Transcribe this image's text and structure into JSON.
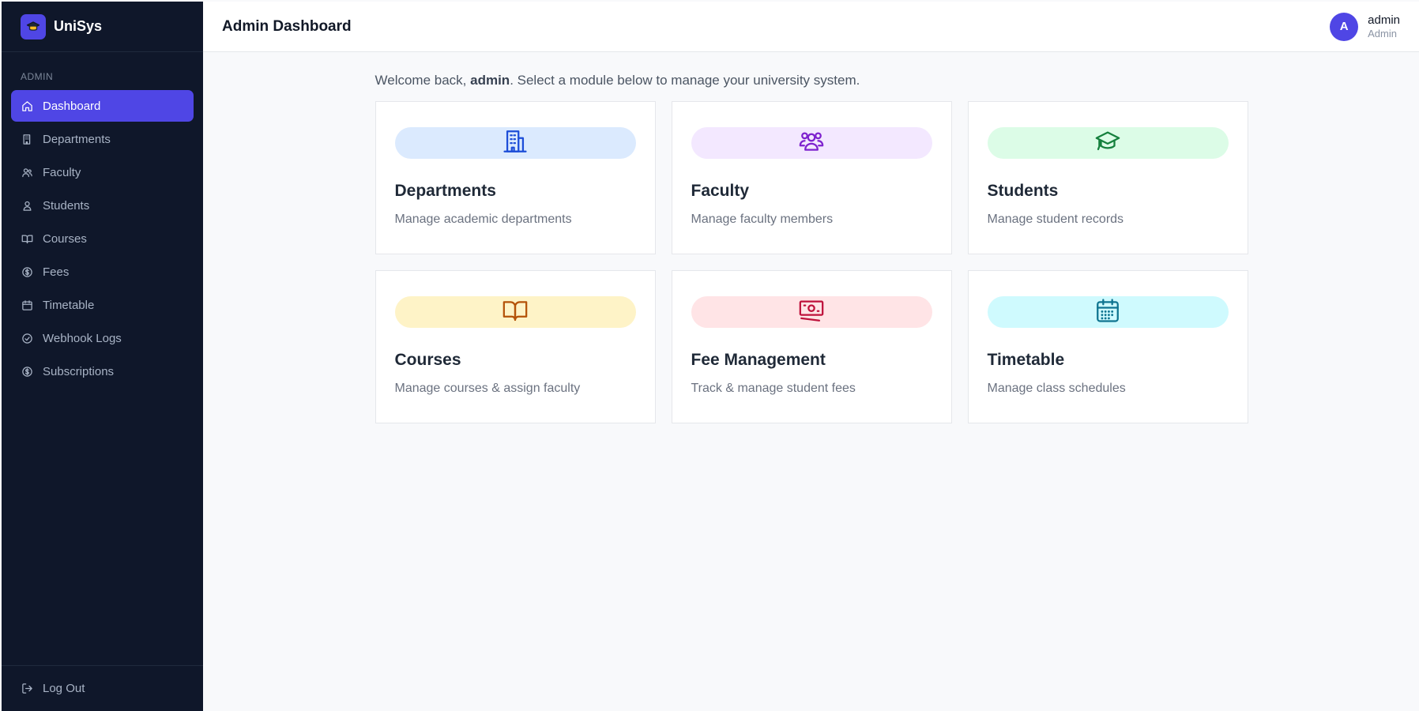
{
  "brand": {
    "name": "UniSys",
    "logo_icon": "graduation-cap-icon"
  },
  "sidebar": {
    "section": "ADMIN",
    "items": [
      {
        "label": "Dashboard",
        "icon": "home-icon",
        "active": true
      },
      {
        "label": "Departments",
        "icon": "building-icon"
      },
      {
        "label": "Faculty",
        "icon": "users-icon"
      },
      {
        "label": "Students",
        "icon": "user-icon"
      },
      {
        "label": "Courses",
        "icon": "book-open-icon"
      },
      {
        "label": "Fees",
        "icon": "dollar-circle-icon"
      },
      {
        "label": "Timetable",
        "icon": "calendar-icon"
      },
      {
        "label": "Webhook Logs",
        "icon": "check-circle-icon"
      },
      {
        "label": "Subscriptions",
        "icon": "dollar-circle-icon"
      }
    ],
    "logout_label": "Log Out"
  },
  "header": {
    "title": "Admin Dashboard",
    "user": {
      "initial": "A",
      "name": "admin",
      "role": "Admin"
    }
  },
  "welcome": {
    "prefix": "Welcome back, ",
    "username": "admin",
    "suffix": ". Select a module below to manage your university system."
  },
  "cards": [
    {
      "title": "Departments",
      "description": "Manage academic departments",
      "icon": "building-icon",
      "bg": "#dbeafe",
      "color": "#1d4ed8"
    },
    {
      "title": "Faculty",
      "description": "Manage faculty members",
      "icon": "users-icon",
      "bg": "#f3e8ff",
      "color": "#7e22ce"
    },
    {
      "title": "Students",
      "description": "Manage student records",
      "icon": "graduation-cap-icon",
      "bg": "#dcfce7",
      "color": "#15803d"
    },
    {
      "title": "Courses",
      "description": "Manage courses & assign faculty",
      "icon": "book-open-icon",
      "bg": "#fef3c7",
      "color": "#b45309"
    },
    {
      "title": "Fee Management",
      "description": "Track & manage student fees",
      "icon": "banknote-icon",
      "bg": "#ffe4e6",
      "color": "#be123c"
    },
    {
      "title": "Timetable",
      "description": "Manage class schedules",
      "icon": "calendar-icon",
      "bg": "#cffafe",
      "color": "#0e7490"
    }
  ],
  "colors": {
    "sidebar_bg": "#0f172a",
    "accent": "#4f46e5",
    "page_bg": "#f8f9fb"
  }
}
